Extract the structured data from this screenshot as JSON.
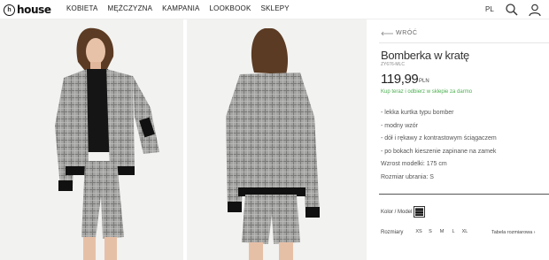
{
  "header": {
    "logo_text": "house",
    "nav": [
      "KOBIETA",
      "MĘŻCZYZNA",
      "KAMPANIA",
      "LOOKBOOK",
      "SKLEPY"
    ],
    "lang": "PL",
    "icons": [
      "search-icon",
      "user-icon"
    ]
  },
  "product": {
    "back_label": "WRÓĆ",
    "title": "Bomberka w kratę",
    "code": "ZY676-MLC",
    "price": "119,99",
    "currency": "PLN",
    "pickup": "Kup teraz i odbierz w sklepie za darmo",
    "features": [
      "- lekka kurtka typu bomber",
      "- modny wzór",
      "- dół i rękawy z kontrastowym ściągaczem",
      "- po bokach kieszenie zapinane na zamek",
      "Wzrost modelki: 175 cm",
      "Rozmiar ubrania: S"
    ],
    "color_label": "Kolor / Model",
    "sizes_label": "Rozmiary",
    "sizes": [
      "XS",
      "S",
      "M",
      "L",
      "XL"
    ],
    "size_chart": "Tabela rozmiarowa ›"
  },
  "photos": [
    "front-view",
    "back-view"
  ],
  "colors": {
    "accent_green": "#4caf50",
    "plaid_gray": "#9a9a98"
  }
}
